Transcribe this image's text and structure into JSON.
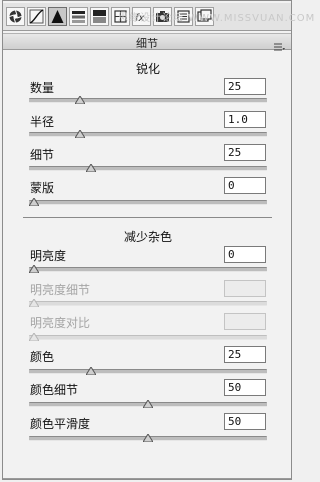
{
  "watermark": "思缘设计论坛 WWW.MISSVUAN.COM",
  "panel": {
    "title": "细节"
  },
  "toolbar": {
    "tools": [
      "aperture-icon",
      "tone-curve-icon",
      "detail-triangle-icon",
      "hsl-icon",
      "split-tone-icon",
      "lens-icon",
      "fx-icon",
      "camera-calibration-icon",
      "presets-icon",
      "snapshots-icon"
    ]
  },
  "sharpen": {
    "title": "锐化",
    "rows": [
      {
        "label": "数量",
        "value": "25",
        "level": 0.2
      },
      {
        "label": "半径",
        "value": "1.0",
        "level": 0.2
      },
      {
        "label": "细节",
        "value": "25",
        "level": 0.25
      },
      {
        "label": "蒙版",
        "value": "0",
        "level": 0.0
      }
    ]
  },
  "noise": {
    "title": "减少杂色",
    "rows": [
      {
        "label": "明亮度",
        "value": "0",
        "level": 0.0,
        "disabled": false
      },
      {
        "label": "明亮度细节",
        "value": "",
        "level": 0.0,
        "disabled": true
      },
      {
        "label": "明亮度对比",
        "value": "",
        "level": 0.0,
        "disabled": true
      },
      {
        "label": "颜色",
        "value": "25",
        "level": 0.25,
        "disabled": false
      },
      {
        "label": "颜色细节",
        "value": "50",
        "level": 0.5,
        "disabled": false
      },
      {
        "label": "颜色平滑度",
        "value": "50",
        "level": 0.5,
        "disabled": false
      }
    ]
  }
}
